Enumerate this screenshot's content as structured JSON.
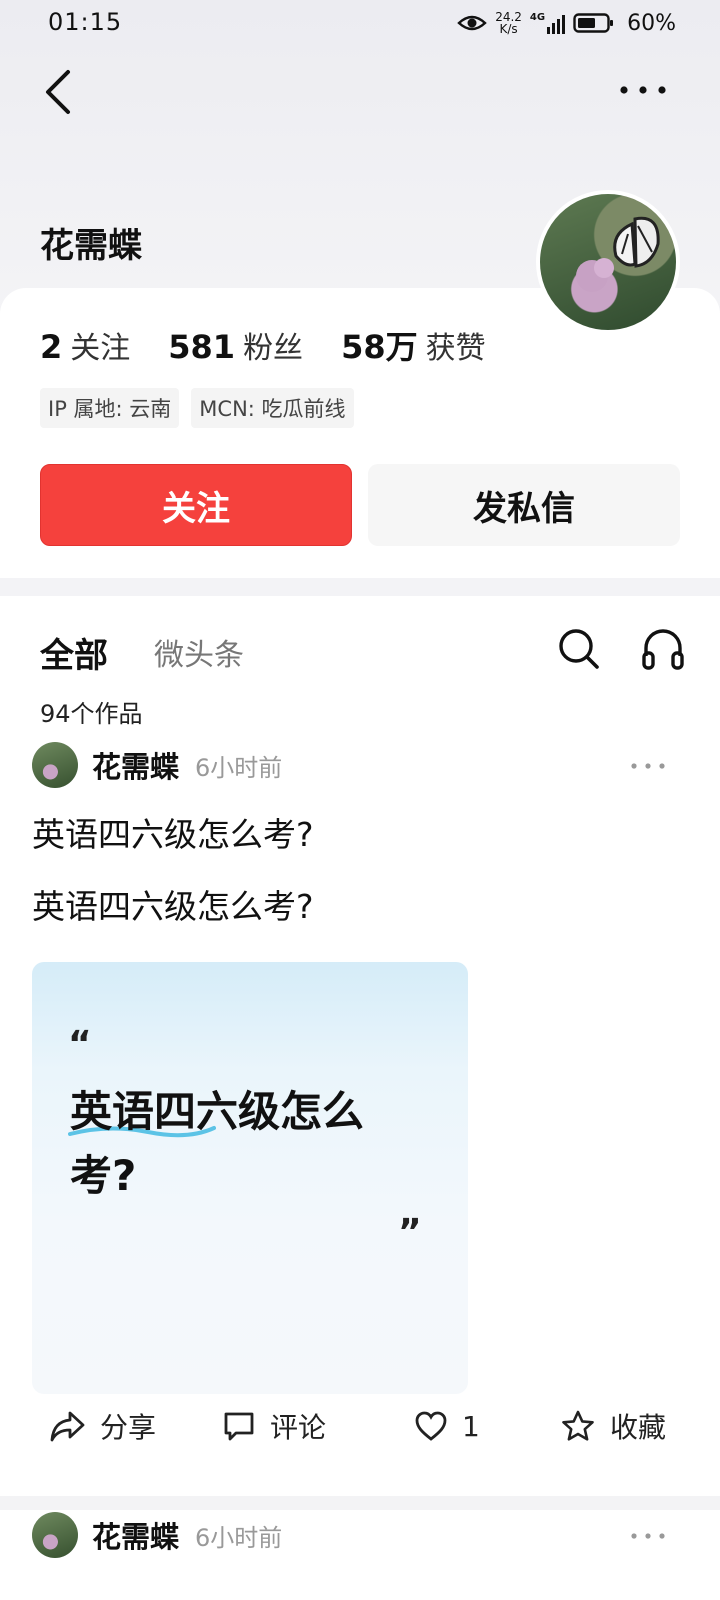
{
  "status_bar": {
    "time": "01:15",
    "net_speed_value": "24.2",
    "net_speed_unit": "K/s",
    "network_type": "4G",
    "battery": "60%"
  },
  "profile": {
    "name": "花需蝶",
    "stats": [
      {
        "number": "2",
        "label": "关注"
      },
      {
        "number": "581",
        "label": "粉丝"
      },
      {
        "number": "58万",
        "label": "获赞"
      }
    ],
    "tags": [
      "IP 属地: 云南",
      "MCN: 吃瓜前线"
    ],
    "follow_label": "关注",
    "message_label": "发私信"
  },
  "tabs": {
    "all": "全部",
    "micro": "微头条"
  },
  "works_count": "94个作品",
  "posts": [
    {
      "author": "花需蝶",
      "time": "6小时前",
      "title": "英语四六级怎么考?",
      "body": "英语四六级怎么考?",
      "card_open_quote": "“",
      "card_text": "英语四六级怎么考?",
      "card_close_quote": "”",
      "actions": {
        "share": "分享",
        "comment": "评论",
        "like_count": "1",
        "collect": "收藏"
      }
    },
    {
      "author": "花需蝶",
      "time": "6小时前"
    }
  ],
  "colors": {
    "accent": "#f5413d",
    "background": "#ffffff",
    "hero_background": "#ececf1"
  },
  "icons": [
    "back-icon",
    "more-icon",
    "search-icon",
    "headphones-icon",
    "share-icon",
    "comment-icon",
    "heart-icon",
    "star-icon",
    "eye-icon",
    "signal-icon",
    "battery-icon"
  ]
}
